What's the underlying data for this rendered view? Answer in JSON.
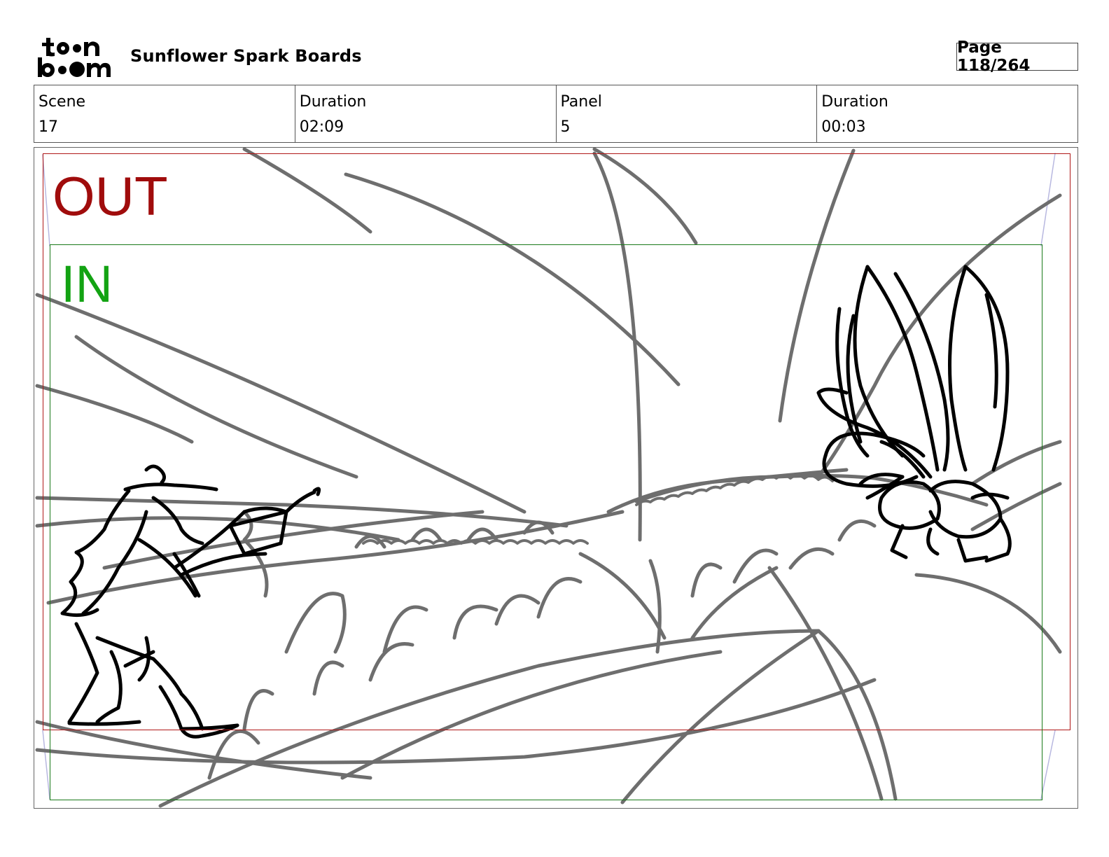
{
  "header": {
    "logo_text": "toon boom",
    "project_title": "Sunflower Spark Boards",
    "page_label": "Page 118/264"
  },
  "info": {
    "scene_label": "Scene",
    "scene_value": "17",
    "scene_duration_label": "Duration",
    "scene_duration_value": "02:09",
    "panel_label": "Panel",
    "panel_value": "5",
    "panel_duration_label": "Duration",
    "panel_duration_value": "00:03"
  },
  "panel": {
    "out_label": "OUT",
    "in_label": "IN",
    "colors": {
      "out_frame": "#b01818",
      "in_frame": "#1a7a1a",
      "out_text": "#a00c0c",
      "in_text": "#13a313",
      "sketch_grey": "#6e6e6e",
      "sketch_ink": "#000000"
    }
  }
}
